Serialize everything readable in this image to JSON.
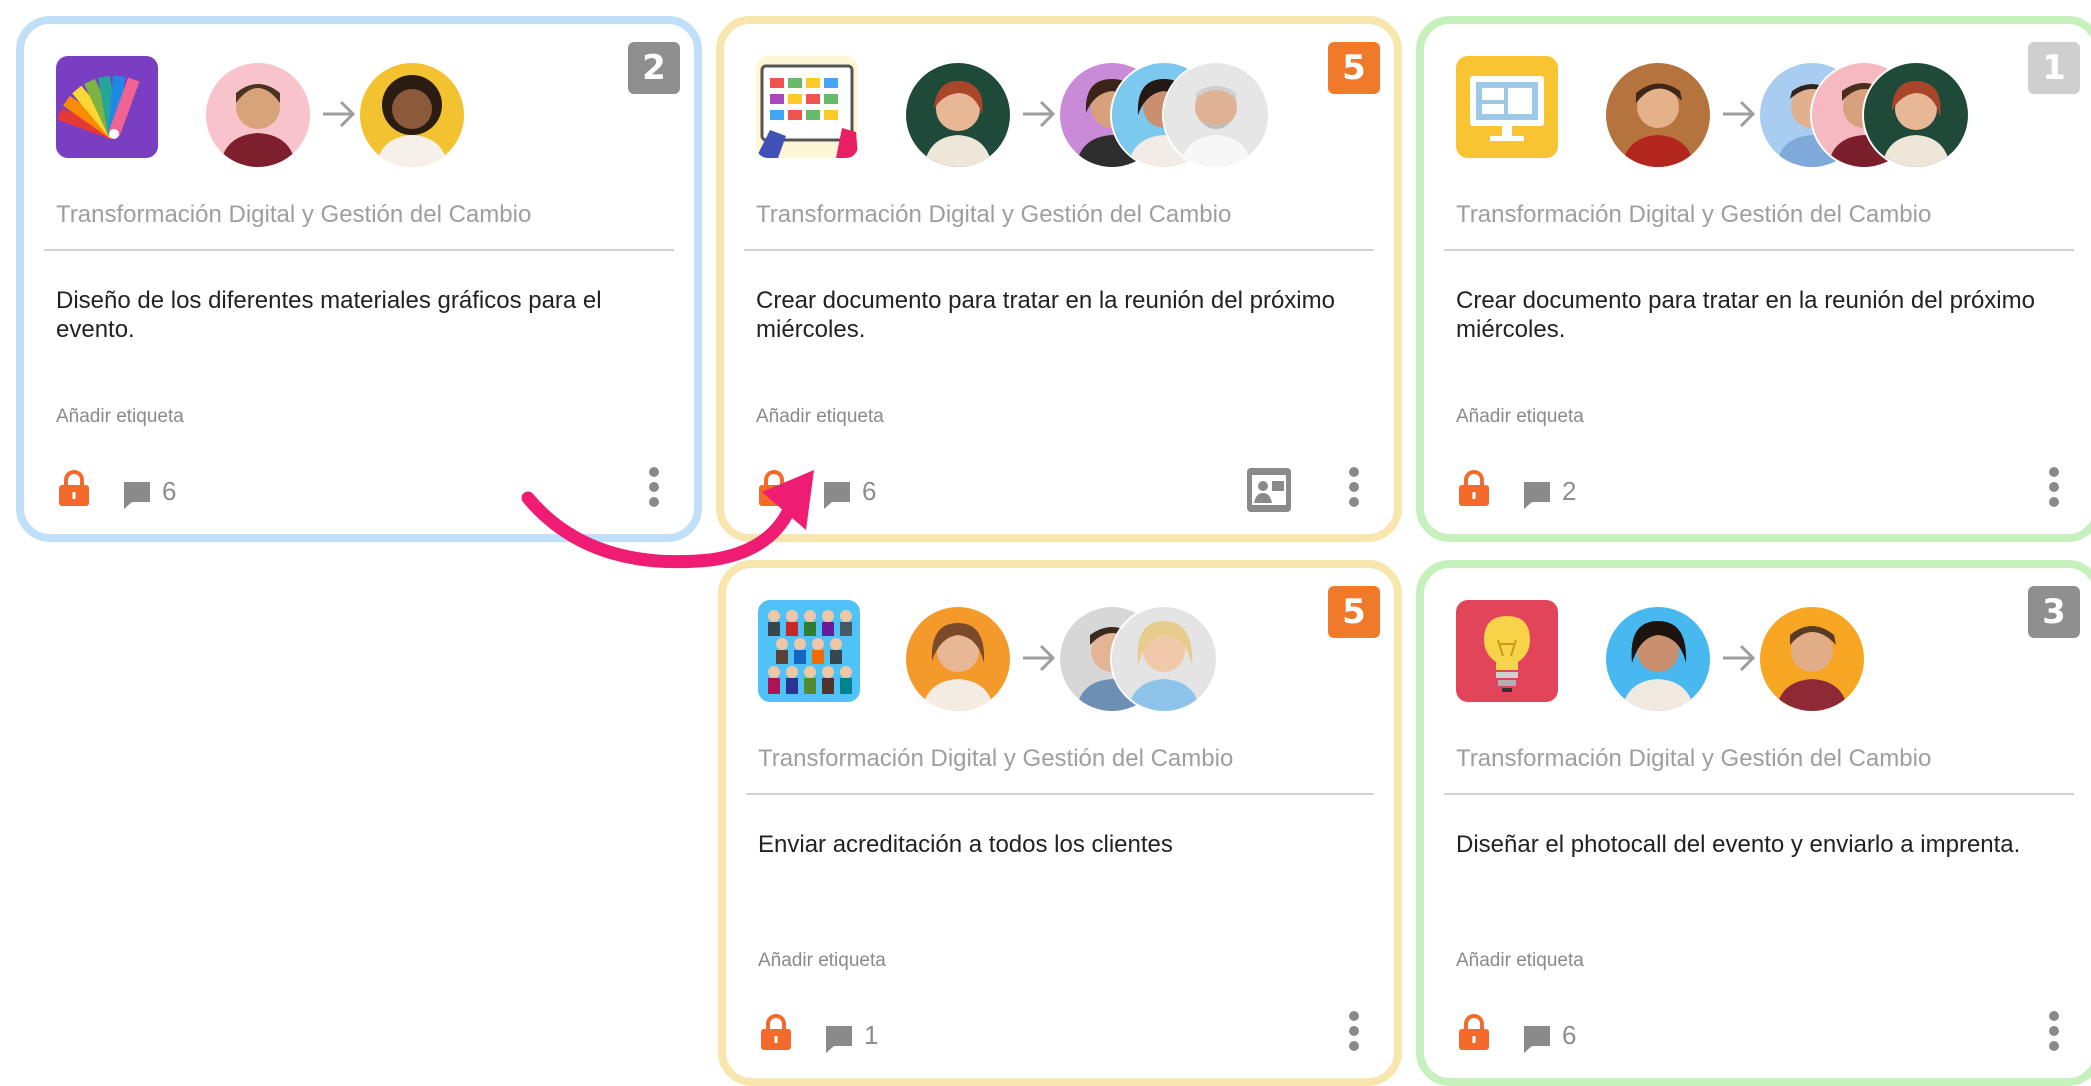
{
  "colors": {
    "blue_border": "#bfe0f8",
    "yellow_border": "#f8e6ae",
    "green_border": "#c6f0bc",
    "badge_gray": "#8f8f8f",
    "badge_orange": "#f07a2a",
    "badge_light": "#cfcfcf",
    "lock_orange": "#f36a2b",
    "curve_pink": "#ee1c72"
  },
  "cards": [
    {
      "priority": "2",
      "project": "Transformación Digital y Gestión del Cambio",
      "description": "Diseño de los diferentes materiales gráficos para el evento.",
      "tag_label": "Añadir etiqueta",
      "comment_count": "6",
      "icon": "color-swatch-icon"
    },
    {
      "priority": "5",
      "project": "Transformación Digital y Gestión del Cambio",
      "description": "Crear documento para tratar en la reunión del próximo miércoles.",
      "tag_label": "Añadir etiqueta",
      "comment_count": "6",
      "icon": "planning-board-icon"
    },
    {
      "priority": "1",
      "project": "Transformación Digital y Gestión del Cambio",
      "description": "Crear documento para tratar en la reunión del próximo miércoles.",
      "tag_label": "Añadir etiqueta",
      "comment_count": "2",
      "icon": "monitor-icon"
    },
    {
      "priority": "5",
      "project": "Transformación Digital y Gestión del Cambio",
      "description": "Enviar acreditación a todos los clientes",
      "tag_label": "Añadir etiqueta",
      "comment_count": "1",
      "icon": "crowd-icon"
    },
    {
      "priority": "3",
      "project": "Transformación Digital y Gestión del Cambio",
      "description": "Diseñar el photocall del evento y enviarlo a imprenta.",
      "tag_label": "Añadir etiqueta",
      "comment_count": "6",
      "icon": "lightbulb-icon"
    }
  ]
}
